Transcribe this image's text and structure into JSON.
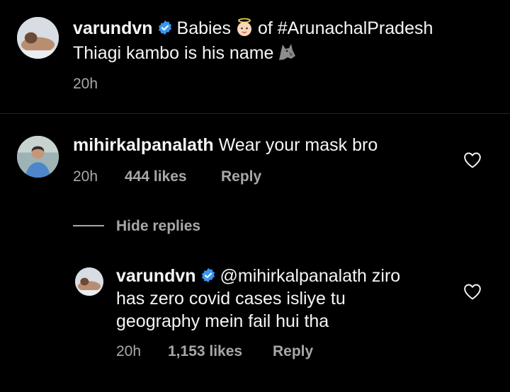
{
  "post": {
    "username": "varundvn",
    "caption_part1": "Babies",
    "caption_part2": "of #ArunachalPradesh",
    "caption_line2": "Thiagi kambo is his name",
    "time": "20h"
  },
  "comment": {
    "username": "mihirkalpanalath",
    "text": "Wear your mask bro",
    "time": "20h",
    "likes": "444 likes",
    "reply_label": "Reply",
    "hide_replies_label": "Hide replies"
  },
  "reply": {
    "username": "varundvn",
    "line1": "@mihirkalpanalath ziro",
    "line2": "has zero covid cases isliye tu",
    "line3": "geography mein fail hui tha",
    "time": "20h",
    "likes": "1,153 likes",
    "reply_label": "Reply"
  },
  "colors": {
    "background": "#000000",
    "text": "#f5f5f5",
    "secondary": "#a8a8a8",
    "verified": "#3897f0"
  },
  "icons": {
    "verified": "verified-badge-icon",
    "baby_angel": "baby-angel-emoji",
    "wolf": "wolf-emoji",
    "heart": "heart-outline-icon"
  }
}
